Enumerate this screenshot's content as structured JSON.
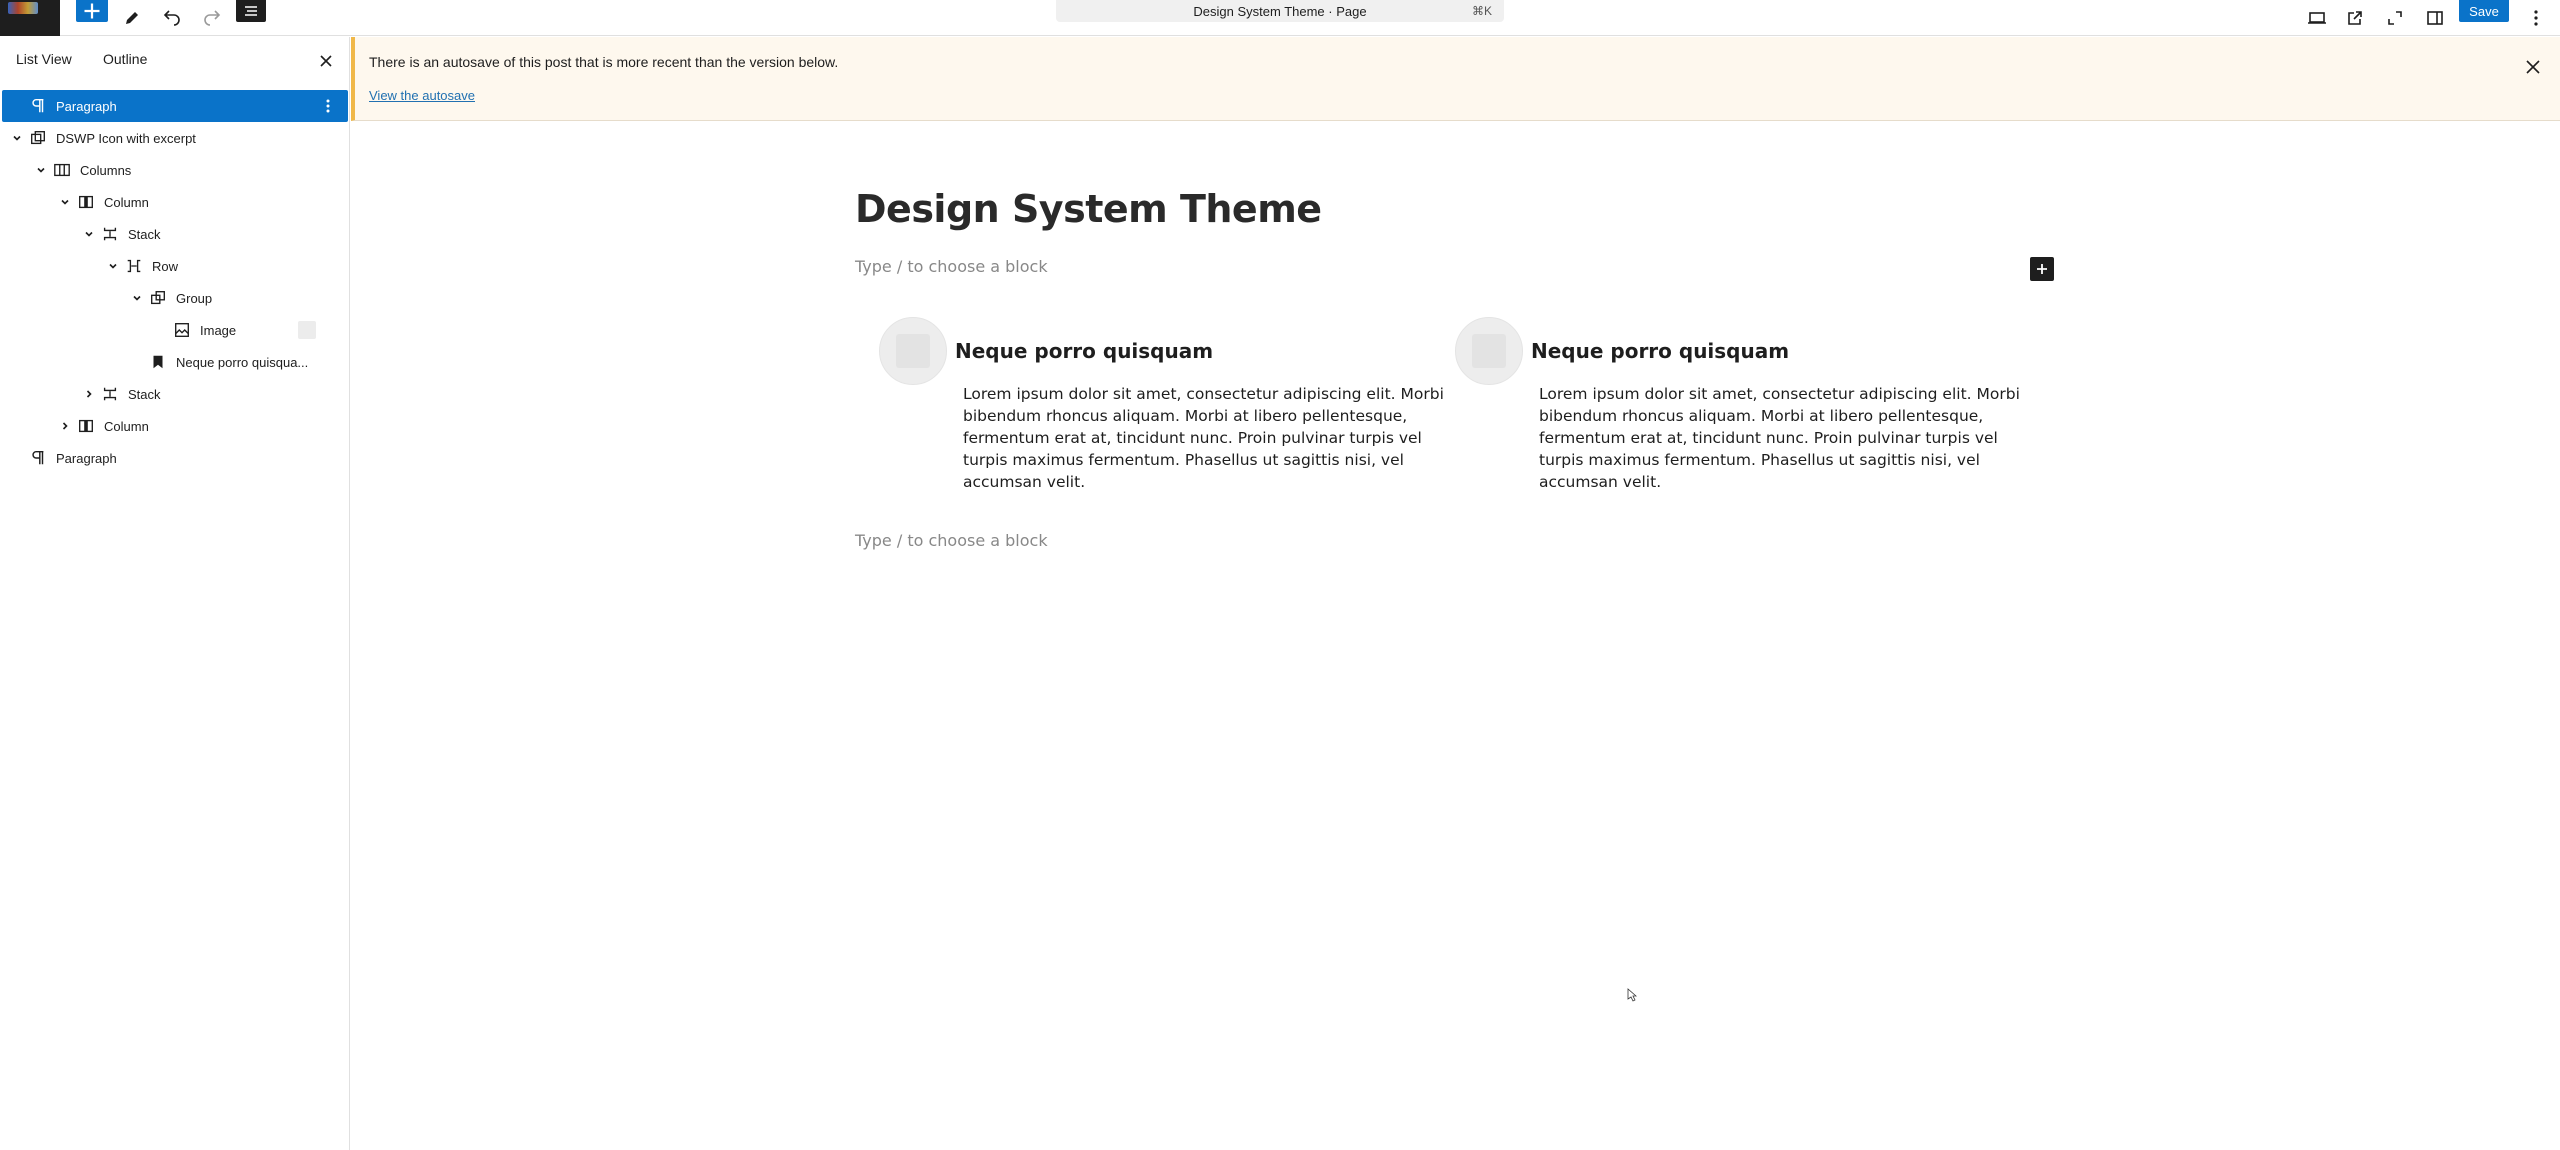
{
  "topbar": {
    "add_label": "+",
    "command_title": "Design System Theme · Page",
    "command_shortcut": "⌘K",
    "save_label": "Save"
  },
  "sidebar": {
    "tabs": [
      "List View",
      "Outline"
    ],
    "tree": [
      {
        "label": "Paragraph",
        "icon": "paragraph-icon",
        "depth": 0,
        "chevron": "none",
        "selected": true
      },
      {
        "label": "DSWP Icon with excerpt",
        "icon": "reusable-block-icon",
        "depth": 0,
        "chevron": "down"
      },
      {
        "label": "Columns",
        "icon": "columns-icon",
        "depth": 1,
        "chevron": "down"
      },
      {
        "label": "Column",
        "icon": "column-icon",
        "depth": 2,
        "chevron": "down"
      },
      {
        "label": "Stack",
        "icon": "stack-icon",
        "depth": 3,
        "chevron": "down"
      },
      {
        "label": "Row",
        "icon": "row-icon",
        "depth": 4,
        "chevron": "down"
      },
      {
        "label": "Group",
        "icon": "group-icon",
        "depth": 5,
        "chevron": "down"
      },
      {
        "label": "Image",
        "icon": "image-icon",
        "depth": 6,
        "chevron": "none",
        "thumb": true
      },
      {
        "label": "Neque porro quisqua...",
        "icon": "heading-bookmark-icon",
        "depth": 5,
        "chevron": "none"
      },
      {
        "label": "Stack",
        "icon": "stack-icon",
        "depth": 3,
        "chevron": "right"
      },
      {
        "label": "Column",
        "icon": "column-icon",
        "depth": 2,
        "chevron": "right"
      },
      {
        "label": "Paragraph",
        "icon": "paragraph-icon",
        "depth": 0,
        "chevron": "none"
      }
    ]
  },
  "notice": {
    "text": "There is an autosave of this post that is more recent than the version below.",
    "link": "View the autosave"
  },
  "editor": {
    "title": "Design System Theme",
    "placeholder_top": "Type / to choose a block",
    "placeholder_bottom": "Type / to choose a block",
    "cards": [
      {
        "heading": "Neque porro quisquam",
        "body": "Lorem ipsum dolor sit amet, consectetur adipiscing elit. Morbi bibendum rhoncus aliquam. Morbi at libero pellentesque, fermentum erat at, tincidunt nunc. Proin pulvinar turpis vel turpis maximus fermentum. Phasellus ut sagittis nisi, vel accumsan velit."
      },
      {
        "heading": "Neque porro quisquam",
        "body": "Lorem ipsum dolor sit amet, consectetur adipiscing elit. Morbi bibendum rhoncus aliquam. Morbi at libero pellentesque, fermentum erat at, tincidunt nunc. Proin pulvinar turpis vel turpis maximus fermentum. Phasellus ut sagittis nisi, vel accumsan velit."
      }
    ]
  },
  "colors": {
    "accent": "#0a73c9",
    "notice_bg": "#fef8ee",
    "notice_border": "#f0b849"
  }
}
